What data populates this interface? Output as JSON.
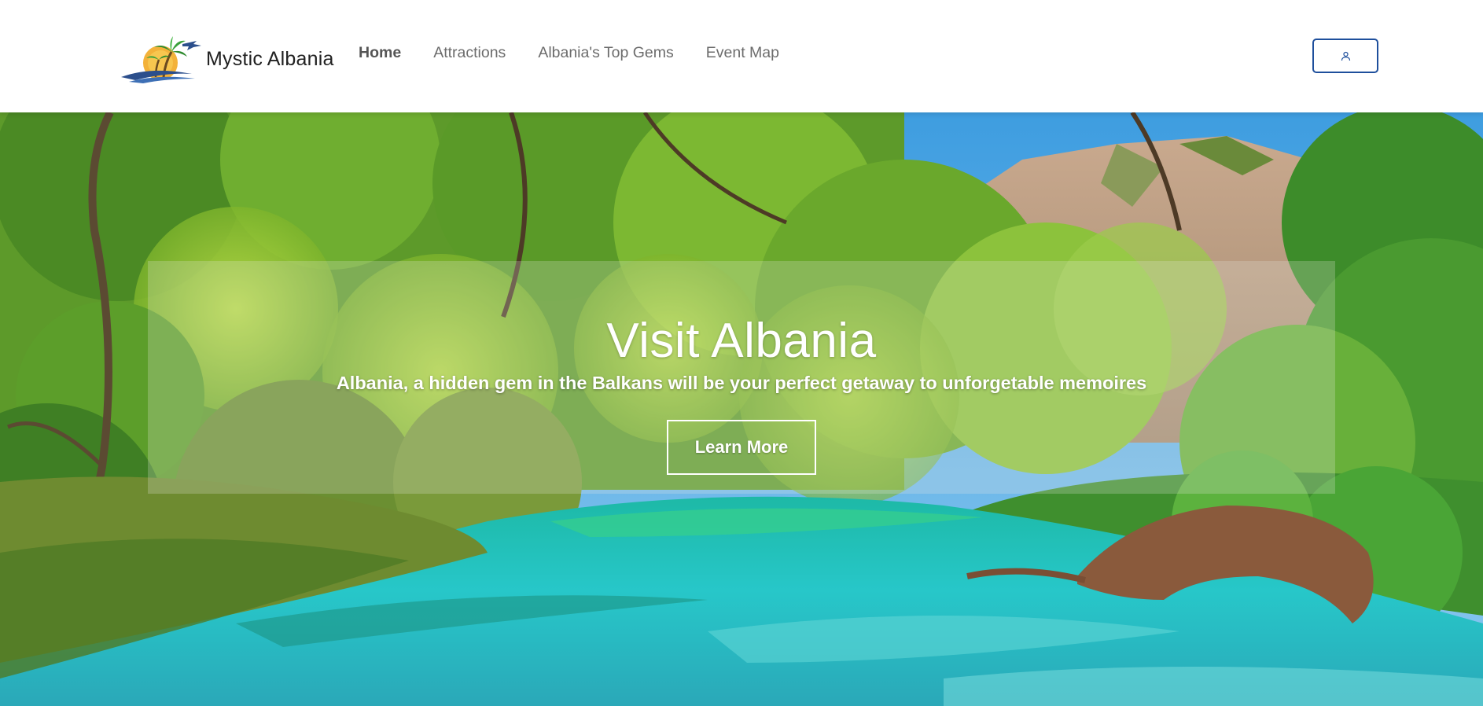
{
  "brand": {
    "name": "Mystic Albania",
    "logo_icon": "palm-tree-sunset-plane-logo"
  },
  "nav": {
    "items": [
      {
        "label": "Home",
        "active": true
      },
      {
        "label": "Attractions",
        "active": false
      },
      {
        "label": "Albania's Top Gems",
        "active": false
      },
      {
        "label": "Event Map",
        "active": false
      }
    ]
  },
  "account": {
    "icon": "user-icon",
    "border_color": "#1e4f9c"
  },
  "hero": {
    "title": "Visit Albania",
    "subtitle": "Albania, a hidden gem in the Balkans will be your perfect getaway to unforgetable memoires",
    "button_label": "Learn More",
    "background": "river-forest-mountain-photo"
  },
  "colors": {
    "nav_text": "#6c6c6c",
    "nav_active": "#555555",
    "hero_text": "#ffffff"
  }
}
